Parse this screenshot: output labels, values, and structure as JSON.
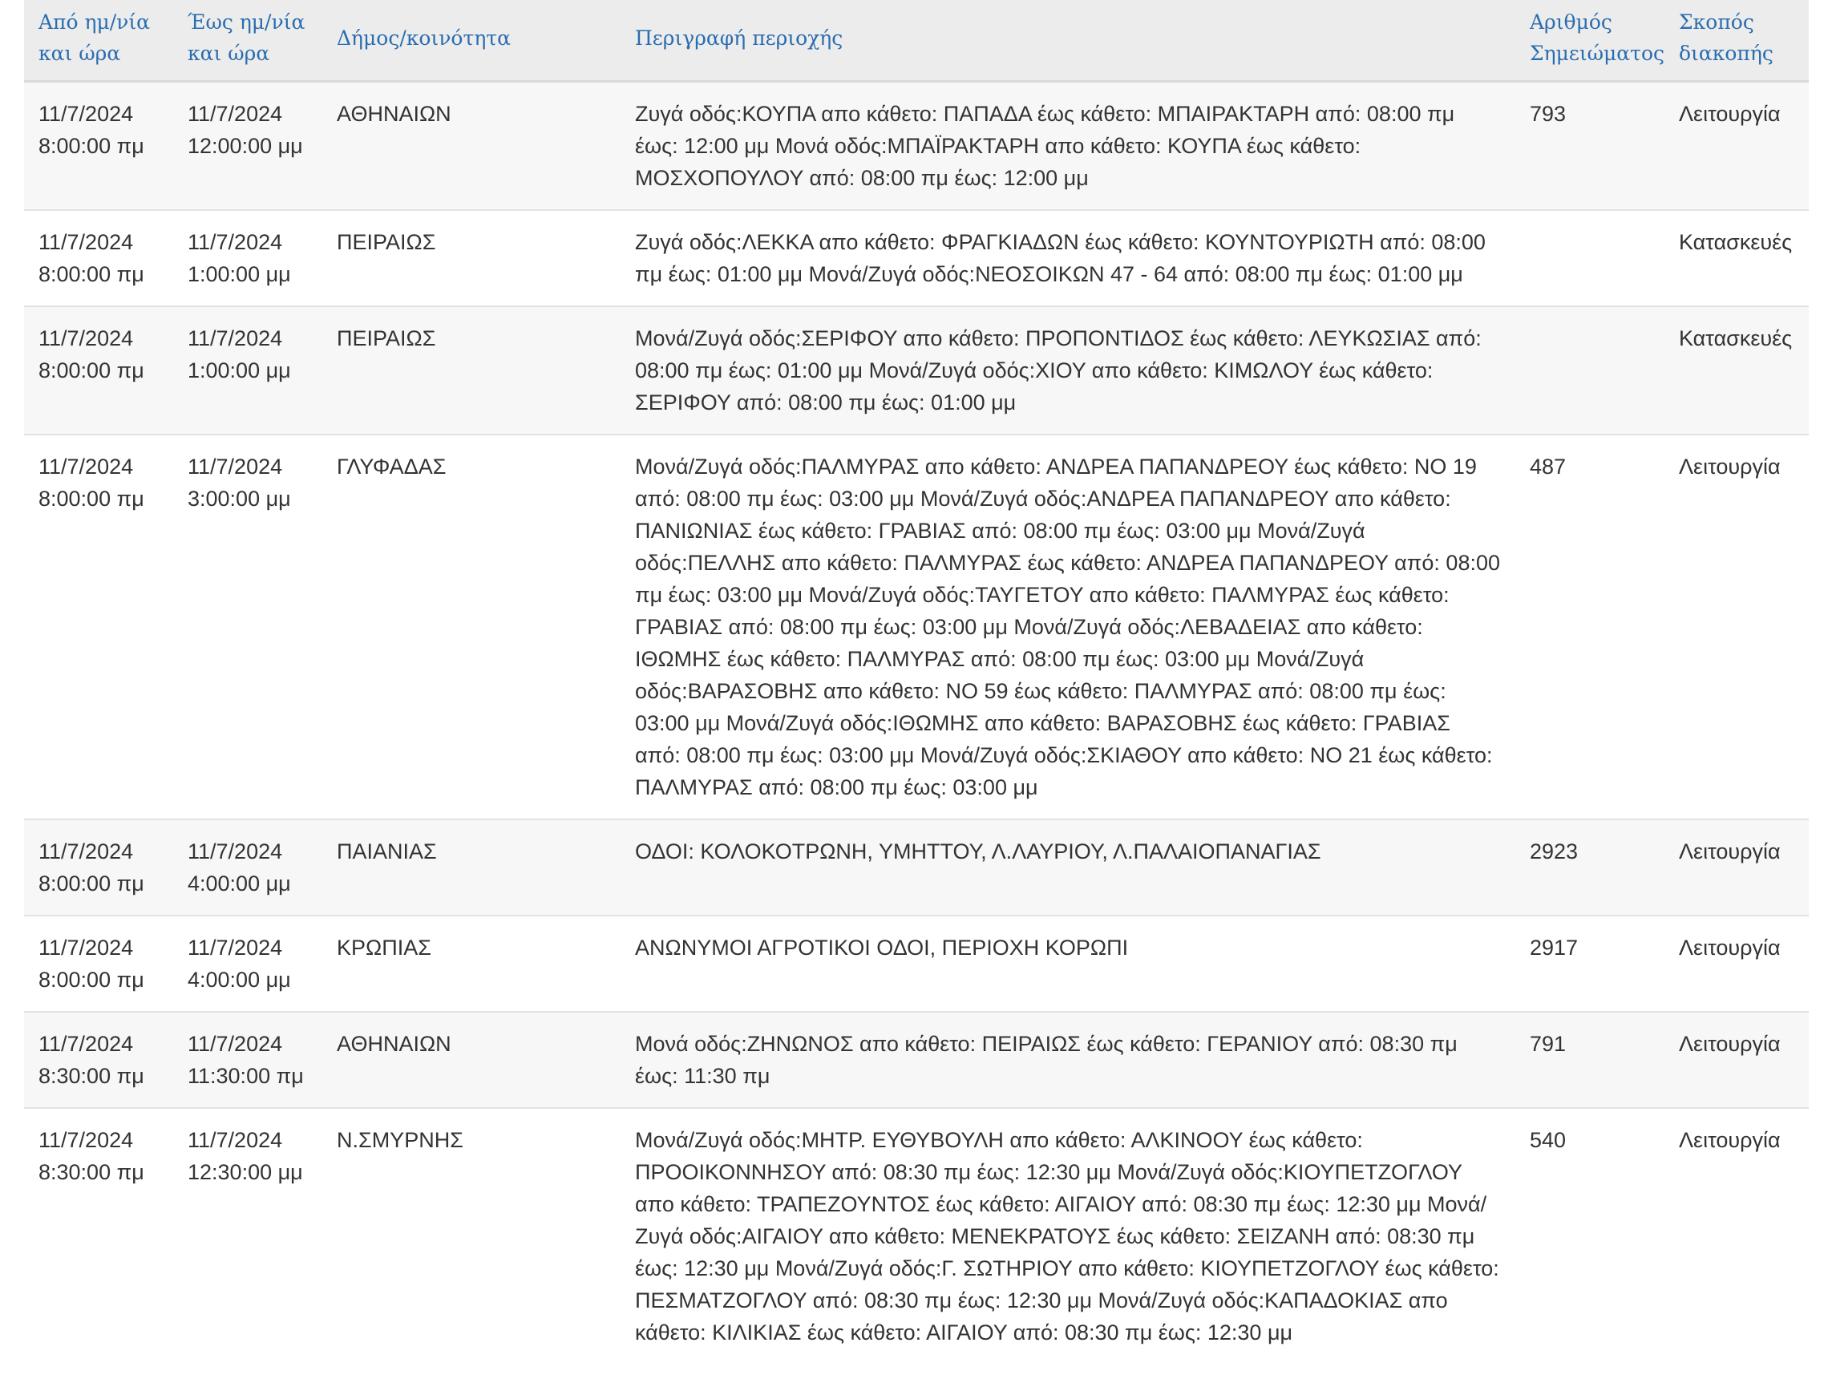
{
  "table": {
    "headers": {
      "from": "Από ημ/νία και ώρα",
      "to": "Έως ημ/νία και ώρα",
      "municipality": "Δήμος/κοινότητα",
      "description": "Περιγραφή περιοχής",
      "note_number": "Αριθμός Σημειώματος",
      "purpose": "Σκοπός διακοπής"
    },
    "rows": [
      {
        "from": "11/7/2024 8:00:00 πμ",
        "to": "11/7/2024 12:00:00 μμ",
        "municipality": "ΑΘΗΝΑΙΩΝ",
        "description": "Ζυγά οδός:ΚΟΥΠΑ απο κάθετο: ΠΑΠΑΔΑ έως κάθετο: ΜΠΑΙΡΑΚΤΑΡΗ από: 08:00 πμ έως: 12:00 μμ Μονά οδός:ΜΠΑΪΡΑΚΤΑΡΗ απο κάθετο: ΚΟΥΠΑ έως κάθετο: ΜΟΣΧΟΠΟΥΛΟΥ από: 08:00 πμ έως: 12:00 μμ",
        "note_number": "793",
        "purpose": "Λειτουργία"
      },
      {
        "from": "11/7/2024 8:00:00 πμ",
        "to": "11/7/2024 1:00:00 μμ",
        "municipality": "ΠΕΙΡΑΙΩΣ",
        "description": "Ζυγά οδός:ΛΕΚΚΑ απο κάθετο: ΦΡΑΓΚΙΑΔΩΝ έως κάθετο: ΚΟΥΝΤΟΥΡΙΩΤΗ από: 08:00 πμ έως: 01:00 μμ Μονά/Ζυγά οδός:ΝΕΟΣΟΙΚΩΝ 47 - 64 από: 08:00 πμ έως: 01:00 μμ",
        "note_number": "",
        "purpose": "Κατασκευές"
      },
      {
        "from": "11/7/2024 8:00:00 πμ",
        "to": "11/7/2024 1:00:00 μμ",
        "municipality": "ΠΕΙΡΑΙΩΣ",
        "description": "Μονά/Ζυγά οδός:ΣΕΡΙΦΟΥ απο κάθετο: ΠΡΟΠΟΝΤΙΔΟΣ έως κάθετο: ΛΕΥΚΩΣΙΑΣ από: 08:00 πμ έως: 01:00 μμ Μονά/Ζυγά οδός:ΧΙΟΥ απο κάθετο: ΚΙΜΩΛΟΥ έως κάθετο: ΣΕΡΙΦΟΥ από: 08:00 πμ έως: 01:00 μμ",
        "note_number": "",
        "purpose": "Κατασκευές"
      },
      {
        "from": "11/7/2024 8:00:00 πμ",
        "to": "11/7/2024 3:00:00 μμ",
        "municipality": "ΓΛΥΦΑΔΑΣ",
        "description": "Μονά/Ζυγά οδός:ΠΑΛΜΥΡΑΣ απο κάθετο: ΑΝΔΡΕΑ ΠΑΠΑΝΔΡΕΟΥ έως κάθετο: ΝΟ 19 από: 08:00 πμ έως: 03:00 μμ Μονά/Ζυγά οδός:ΑΝΔΡΕΑ ΠΑΠΑΝΔΡΕΟΥ απο κάθετο: ΠΑΝΙΩΝΙΑΣ έως κάθετο: ΓΡΑΒΙΑΣ από: 08:00 πμ έως: 03:00 μμ Μονά/Ζυγά οδός:ΠΕΛΛΗΣ απο κάθετο: ΠΑΛΜΥΡΑΣ έως κάθετο: ΑΝΔΡΕΑ ΠΑΠΑΝΔΡΕΟΥ από: 08:00 πμ έως: 03:00 μμ Μονά/Ζυγά οδός:ΤΑΥΓΕΤΟΥ απο κάθετο: ΠΑΛΜΥΡΑΣ έως κάθετο: ΓΡΑΒΙΑΣ από: 08:00 πμ έως: 03:00 μμ Μονά/Ζυγά οδός:ΛΕΒΑΔΕΙΑΣ απο κάθετο: ΙΘΩΜΗΣ έως κάθετο: ΠΑΛΜΥΡΑΣ από: 08:00 πμ έως: 03:00 μμ Μονά/Ζυγά οδός:ΒΑΡΑΣΟΒΗΣ απο κάθετο: ΝΟ 59 έως κάθετο: ΠΑΛΜΥΡΑΣ από: 08:00 πμ έως: 03:00 μμ Μονά/Ζυγά οδός:ΙΘΩΜΗΣ απο κάθετο: ΒΑΡΑΣΟΒΗΣ έως κάθετο: ΓΡΑΒΙΑΣ από: 08:00 πμ έως: 03:00 μμ Μονά/Ζυγά οδός:ΣΚΙΑΘΟΥ απο κάθετο: ΝΟ 21 έως κάθετο: ΠΑΛΜΥΡΑΣ από: 08:00 πμ έως: 03:00 μμ",
        "note_number": "487",
        "purpose": "Λειτουργία"
      },
      {
        "from": "11/7/2024 8:00:00 πμ",
        "to": "11/7/2024 4:00:00 μμ",
        "municipality": "ΠΑΙΑΝΙΑΣ",
        "description": "ΟΔΟΙ: ΚΟΛΟΚΟΤΡΩΝΗ, ΥΜΗΤΤΟΥ, Λ.ΛΑΥΡΙΟΥ, Λ.ΠΑΛΑΙΟΠΑΝΑΓΙΑΣ",
        "note_number": "2923",
        "purpose": "Λειτουργία"
      },
      {
        "from": "11/7/2024 8:00:00 πμ",
        "to": "11/7/2024 4:00:00 μμ",
        "municipality": "ΚΡΩΠΙΑΣ",
        "description": "ΑΝΩΝΥΜΟΙ ΑΓΡΟΤΙΚΟΙ ΟΔΟΙ, ΠΕΡΙΟΧΗ ΚΟΡΩΠΙ",
        "note_number": "2917",
        "purpose": "Λειτουργία"
      },
      {
        "from": "11/7/2024 8:30:00 πμ",
        "to": "11/7/2024 11:30:00 πμ",
        "municipality": "ΑΘΗΝΑΙΩΝ",
        "description": "Μονά οδός:ΖΗΝΩΝΟΣ απο κάθετο: ΠΕΙΡΑΙΩΣ έως κάθετο: ΓΕΡΑΝΙΟΥ από: 08:30 πμ έως: 11:30 πμ",
        "note_number": "791",
        "purpose": "Λειτουργία"
      },
      {
        "from": "11/7/2024 8:30:00 πμ",
        "to": "11/7/2024 12:30:00 μμ",
        "municipality": "Ν.ΣΜΥΡΝΗΣ",
        "description": "Μονά/Ζυγά οδός:ΜΗΤΡ. ΕΥΘΥΒΟΥΛΗ απο κάθετο: ΑΛΚΙΝΟΟΥ έως κάθετο: ΠΡΟΟΙΚΟΝΝΗΣΟΥ από: 08:30 πμ έως: 12:30 μμ Μονά/Ζυγά οδός:ΚΙΟΥΠΕΤΖΟΓΛΟΥ απο κάθετο: ΤΡΑΠΕΖΟΥΝΤΟΣ έως κάθετο: ΑΙΓΑΙΟΥ από: 08:30 πμ έως: 12:30 μμ Μονά/Ζυγά οδός:ΑΙΓΑΙΟΥ απο κάθετο: ΜΕΝΕΚΡΑΤΟΥΣ έως κάθετο: ΣΕΙΖΑΝΗ από: 08:30 πμ έως: 12:30 μμ Μονά/Ζυγά οδός:Γ. ΣΩΤΗΡΙΟΥ απο κάθετο: ΚΙΟΥΠΕΤΖΟΓΛΟΥ έως κάθετο: ΠΕΣΜΑΤΖΟΓΛΟΥ από: 08:30 πμ έως: 12:30 μμ Μονά/Ζυγά οδός:ΚΑΠΑΔΟΚΙΑΣ απο κάθετο: ΚΙΛΙΚΙΑΣ έως κάθετο: ΑΙΓΑΙΟΥ από: 08:30 πμ έως: 12:30 μμ",
        "note_number": "540",
        "purpose": "Λειτουργία"
      }
    ]
  },
  "colors": {
    "header_text": "#2a6db0",
    "header_background": "#ececec",
    "body_text": "#333333",
    "row_stripe": "#f7f7f7",
    "border": "#e2e2e2"
  }
}
